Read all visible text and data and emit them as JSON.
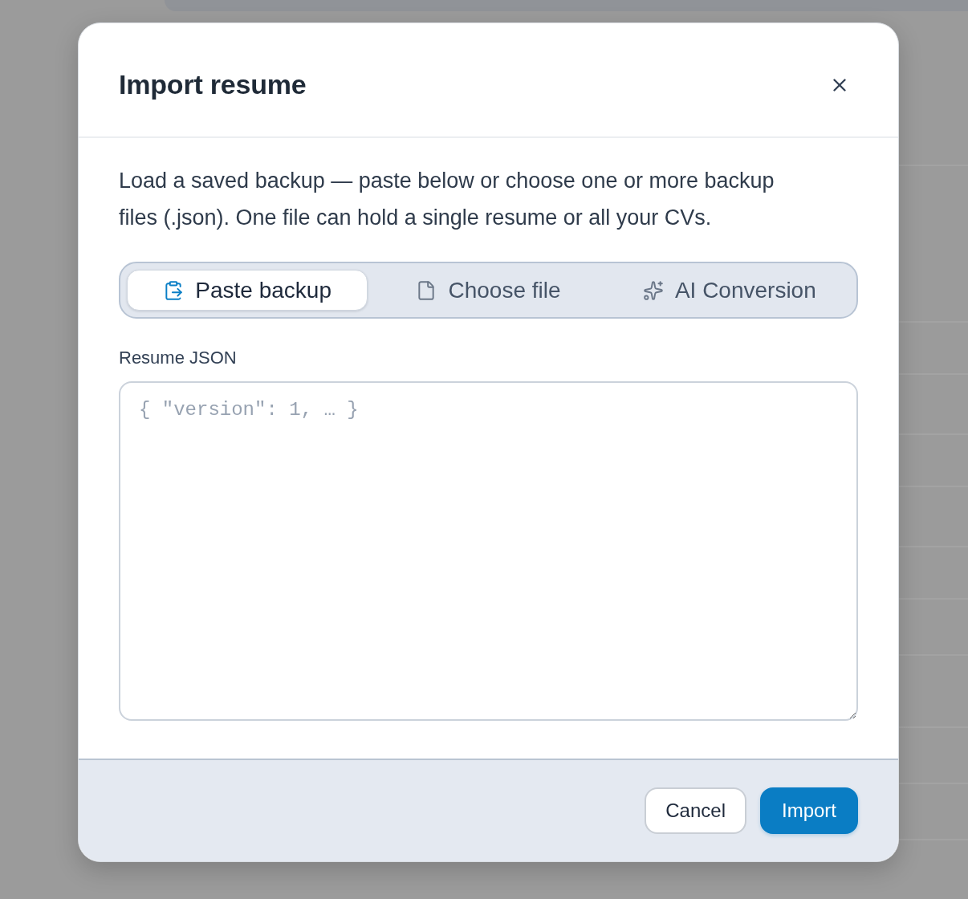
{
  "dialog": {
    "title": "Import resume"
  },
  "description": "Load a saved backup — paste below or choose one or more backup files (.json). One file can hold a single resume or all your CVs.",
  "tabs": [
    {
      "label": "Paste backup",
      "kind": "paste",
      "selected": true
    },
    {
      "label": "Choose file",
      "kind": "file",
      "selected": false
    },
    {
      "label": "AI Conversion",
      "kind": "ai",
      "selected": false
    }
  ],
  "field": {
    "label": "Resume JSON",
    "placeholder": "{ \"version\": 1, … }"
  },
  "buttons": [
    {
      "label": "Cancel",
      "kind": "secondary"
    },
    {
      "label": "Import",
      "kind": "primary"
    }
  ]
}
